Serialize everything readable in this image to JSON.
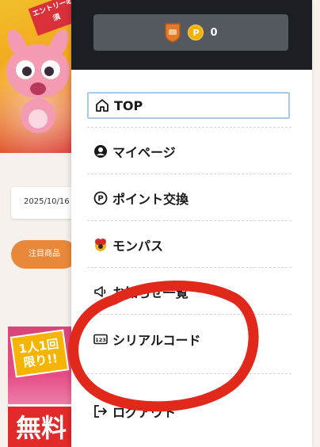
{
  "background": {
    "hero_ribbon": "エントリー必須",
    "date_text": "2025/10/16",
    "featured_pill": "注目商品",
    "banner_badge": "1人1回限り!!",
    "banner_free": "無料"
  },
  "menu": {
    "points": "0",
    "coin_letter": "P",
    "items": [
      {
        "label": "TOP",
        "icon": "home-icon"
      },
      {
        "label": "マイページ",
        "icon": "user-circle-icon"
      },
      {
        "label": "ポイント交換",
        "icon": "points-circle-icon"
      },
      {
        "label": "モンパス",
        "icon": "monpass-icon"
      },
      {
        "label": "お知らせ一覧",
        "icon": "megaphone-icon"
      },
      {
        "label": "シリアルコード",
        "icon": "serial-code-icon"
      },
      {
        "label": "ログアウト",
        "icon": "logout-icon"
      }
    ]
  },
  "colors": {
    "header_bg": "#1b1e22",
    "points_box": "#54585f",
    "coin": "#f3b000",
    "annotation": "#e0281b"
  }
}
